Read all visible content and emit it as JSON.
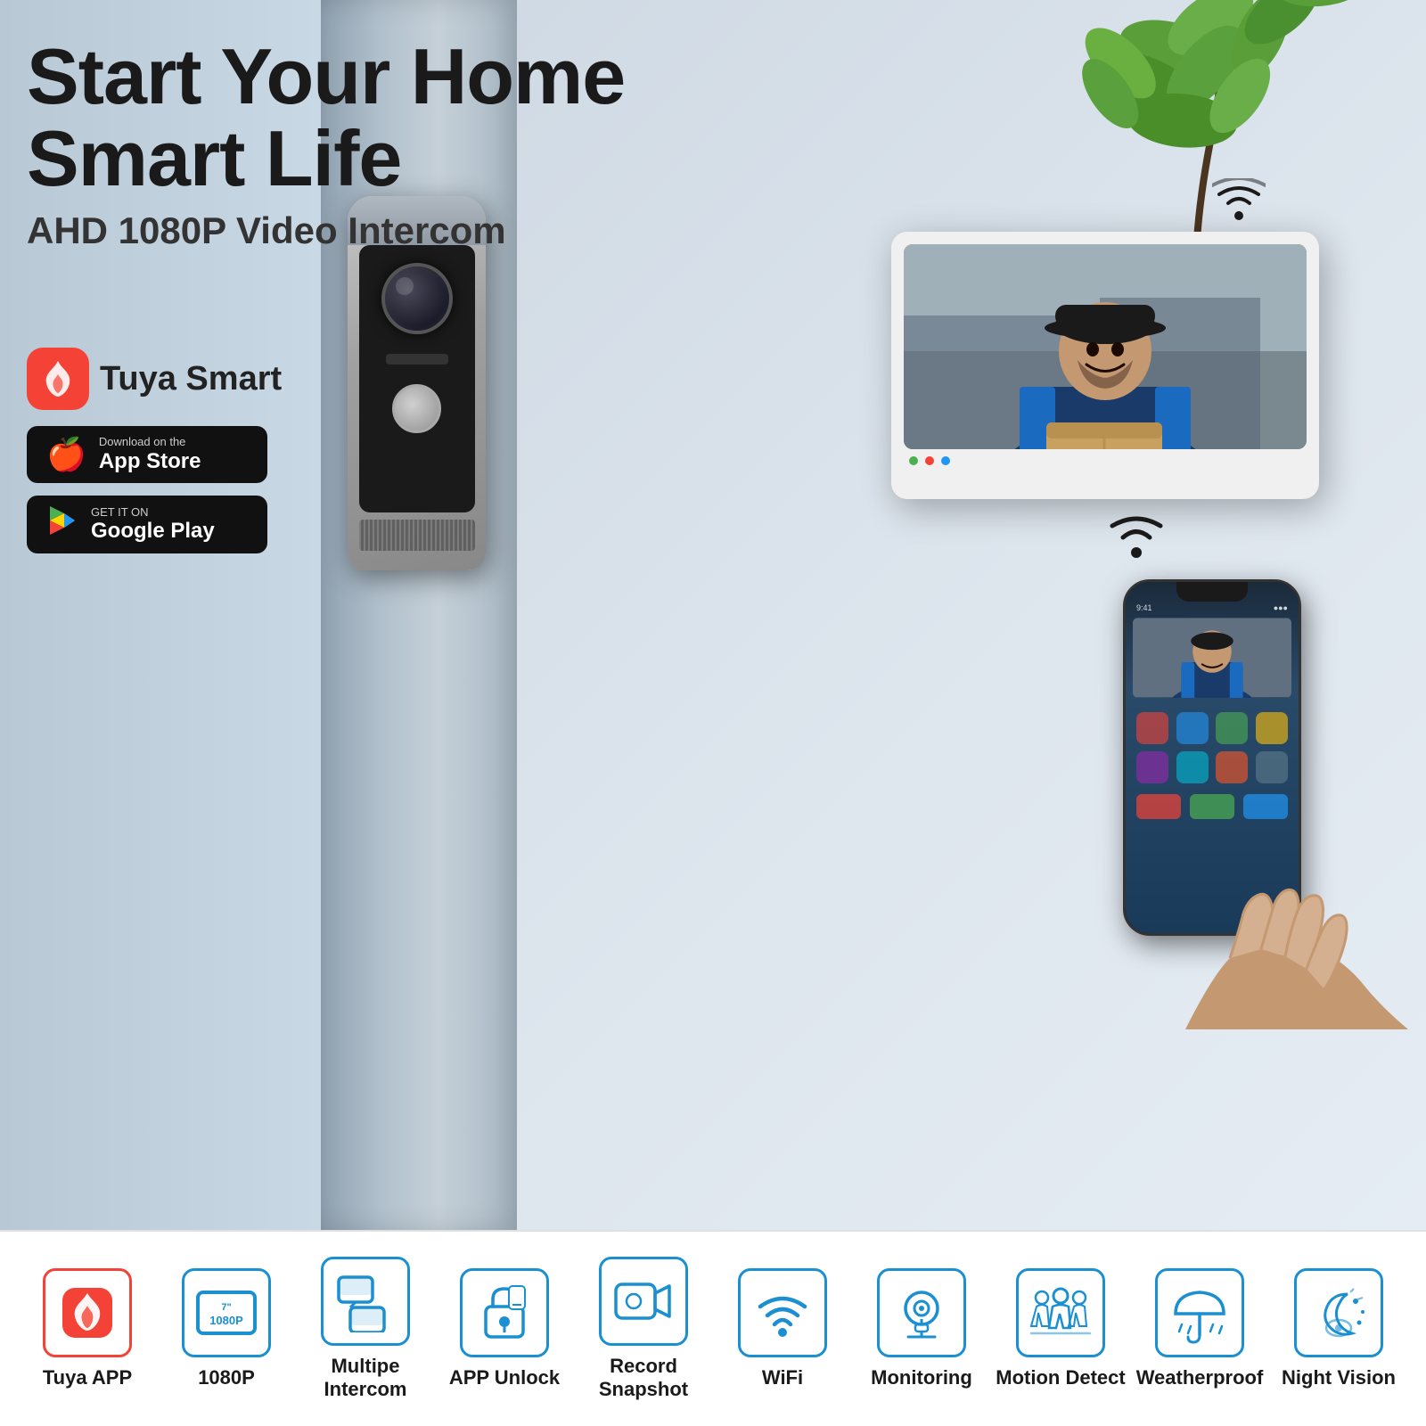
{
  "hero": {
    "title_line1": "Start Your Home",
    "title_line2": "Smart Life",
    "subtitle": "AHD 1080P Video Intercom"
  },
  "tuya": {
    "name": "Tuya Smart",
    "icon_letter": "T"
  },
  "app_store": {
    "small_text": "Download on the",
    "large_text": "App Store",
    "icon": "🍎"
  },
  "google_play": {
    "small_text": "GET IT ON",
    "large_text": "Google Play",
    "icon": "▶"
  },
  "features": [
    {
      "id": "tuya-app",
      "label": "Tuya APP",
      "icon": "T",
      "special": "tuya"
    },
    {
      "id": "resolution",
      "label": "1080P",
      "icon": "7\""
    },
    {
      "id": "multipe-intercom",
      "label": "Multipe\nIntercom",
      "icon": "⊞"
    },
    {
      "id": "app-unlock",
      "label": "APP Unlock",
      "icon": "🔓"
    },
    {
      "id": "record-snapshot",
      "label": "Record\nSnapshot",
      "icon": "🎥"
    },
    {
      "id": "wifi",
      "label": "WiFi",
      "icon": "📶"
    },
    {
      "id": "monitoring",
      "label": "Monitoring",
      "icon": "📷"
    },
    {
      "id": "motion-detect",
      "label": "Motion Detect",
      "icon": "🚶"
    },
    {
      "id": "weatherproof",
      "label": "Weatherproof",
      "icon": "☂"
    },
    {
      "id": "night-vision",
      "label": "Night Vision",
      "icon": "🌙"
    }
  ],
  "colors": {
    "accent_blue": "#1a8fd1",
    "tuya_red": "#f44336",
    "text_dark": "#1a1a1a",
    "bg_light": "#e8eef5"
  }
}
